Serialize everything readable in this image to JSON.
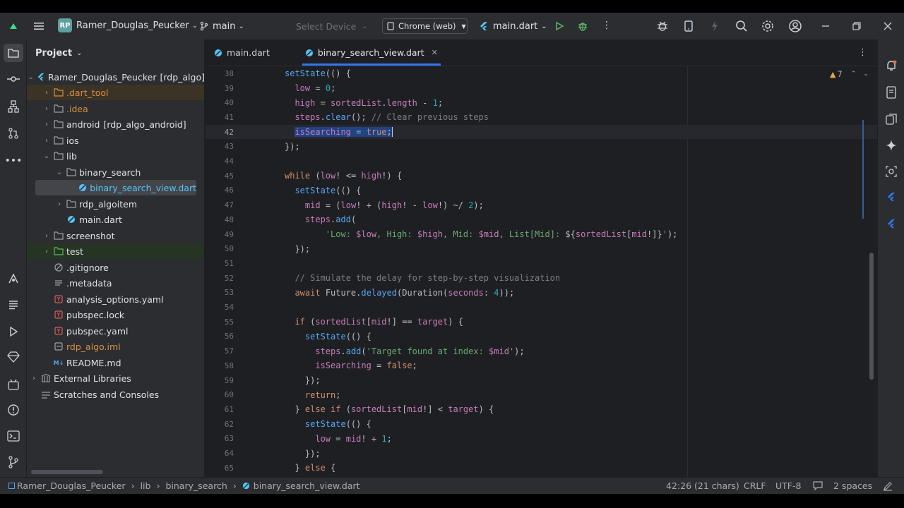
{
  "titlebar": {
    "project_badge": "RP",
    "project_name": "Ramer_Douglas_Peucker",
    "branch": "main",
    "device": "Select Device",
    "browser": "Chrome (web)",
    "run_config": "main.dart"
  },
  "project_panel": {
    "title": "Project",
    "items": [
      {
        "label": "Ramer_Douglas_Peucker",
        "suffix": "[rdp_algo]"
      },
      {
        "label": ".dart_tool"
      },
      {
        "label": ".idea"
      },
      {
        "label": "android",
        "suffix": "[rdp_algo_android]"
      },
      {
        "label": "ios"
      },
      {
        "label": "lib"
      },
      {
        "label": "binary_search"
      },
      {
        "label": "binary_search_view.dart"
      },
      {
        "label": "rdp_algoitem"
      },
      {
        "label": "main.dart"
      },
      {
        "label": "screenshot"
      },
      {
        "label": "test"
      },
      {
        "label": ".gitignore"
      },
      {
        "label": ".metadata"
      },
      {
        "label": "analysis_options.yaml"
      },
      {
        "label": "pubspec.lock"
      },
      {
        "label": "pubspec.yaml"
      },
      {
        "label": "rdp_algo.iml"
      },
      {
        "label": "README.md"
      },
      {
        "label": "External Libraries"
      },
      {
        "label": "Scratches and Consoles"
      }
    ]
  },
  "tabs": [
    {
      "label": "main.dart"
    },
    {
      "label": "binary_search_view.dart"
    }
  ],
  "inspections": {
    "warnings": "7"
  },
  "code": {
    "line_numbers": [
      "38",
      "39",
      "40",
      "41",
      "42",
      "43",
      "44",
      "45",
      "46",
      "47",
      "48",
      "49",
      "50",
      "51",
      "52",
      "53",
      "54",
      "55",
      "56",
      "57",
      "58",
      "59",
      "60",
      "61",
      "62",
      "63",
      "64",
      "65"
    ],
    "lines": [
      "setState(() {",
      "  low = 0;",
      "  high = sortedList.length - 1;",
      "  steps.clear(); // Clear previous steps",
      "  isSearching = true;",
      "});",
      "",
      "while (low! <= high!) {",
      "  setState(() {",
      "    mid = (low! + (high! - low!) ~/ 2);",
      "    steps.add(",
      "        'Low: $low, High: $high, Mid: $mid, List[Mid]: ${sortedList[mid!]}');",
      "  });",
      "",
      "  // Simulate the delay for step-by-step visualization",
      "  await Future.delayed(Duration(seconds: 4));",
      "",
      "  if (sortedList[mid!] == target) {",
      "    setState(() {",
      "      steps.add('Target found at index: $mid');",
      "      isSearching = false;",
      "    });",
      "    return;",
      "  } else if (sortedList[mid!] < target) {",
      "    setState(() {",
      "      low = mid! + 1;",
      "    });",
      "  } else {"
    ]
  },
  "breadcrumb": [
    "Ramer_Douglas_Peucker",
    "lib",
    "binary_search",
    "binary_search_view.dart"
  ],
  "status": {
    "position": "42:26 (21 chars)",
    "line_ending": "CRLF",
    "encoding": "UTF-8",
    "indent": "2 spaces"
  },
  "colors": {
    "accent": "#3574f0",
    "flutter": "#54c5f8",
    "run": "#5fb865"
  }
}
